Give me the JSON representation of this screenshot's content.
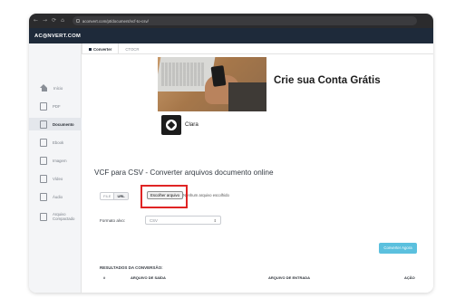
{
  "browser": {
    "nav_back": "←",
    "nav_forward": "→",
    "nav_reload": "⟳",
    "nav_home": "⌂",
    "url": "aconvert.com/pt/document/vcf-to-csv/"
  },
  "app": {
    "logo": "AC◎NVERT.COM"
  },
  "sidebar": {
    "items": [
      {
        "label": "Início",
        "icon": "home-icon"
      },
      {
        "label": "PDF",
        "icon": "pdf-icon"
      },
      {
        "label": "Documento",
        "icon": "document-icon",
        "active": true
      },
      {
        "label": "Ebook",
        "icon": "ebook-icon"
      },
      {
        "label": "Imagem",
        "icon": "image-icon"
      },
      {
        "label": "Vídeo",
        "icon": "video-icon"
      },
      {
        "label": "Áudio",
        "icon": "audio-icon"
      },
      {
        "label": "Arquivo Compactado",
        "icon": "archive-icon"
      }
    ]
  },
  "tabs": [
    {
      "label": "Converter",
      "active": true
    },
    {
      "label": "CTOCR",
      "active": false
    }
  ],
  "ad": {
    "headline": "Crie sua Conta Grátis",
    "brand": "Clara"
  },
  "converter": {
    "title": "VCF para CSV - Converter arquivos documento online",
    "source_file": "FILE",
    "source_url": "URL",
    "file_button": "Escolher arquivo",
    "file_status": "Nenhum arquivo escolhido",
    "format_label": "Formato alvo:",
    "format_value": "CSV",
    "convert_button": "Converter Agora"
  },
  "results": {
    "title": "RESULTADOS DA CONVERSÃO:",
    "columns": [
      "#",
      "ARQUIVO DE SAÍDA",
      "ARQUIVO DE ENTRADA",
      "AÇÃO"
    ]
  },
  "colors": {
    "appbar": "#1e2a3a",
    "highlight": "#e02424",
    "convert_button": "#5bc0de"
  }
}
